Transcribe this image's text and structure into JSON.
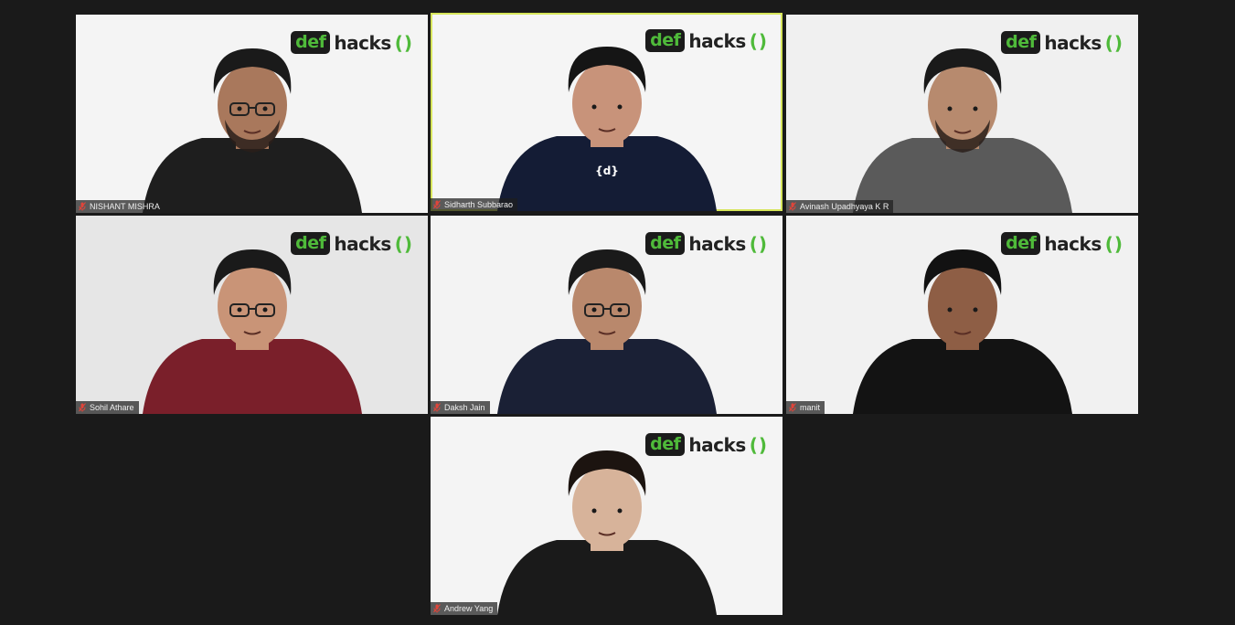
{
  "tiles": [
    {
      "id": "t1",
      "name": "NISHANT MISHRA",
      "bg": "#f4f4f4",
      "shirt": "#1e1e1e",
      "skin": "#a9785c",
      "hair": "#1a1a1a",
      "glasses": true,
      "beard": true,
      "active": false
    },
    {
      "id": "t2",
      "name": "Sidharth Subbarao",
      "bg": "#f5f5f5",
      "shirt": "#141c35",
      "skin": "#c8937a",
      "hair": "#151515",
      "glasses": false,
      "beard": false,
      "active": true,
      "shirt_logo": "{d}"
    },
    {
      "id": "t3",
      "name": "Avinash Upadhyaya K R",
      "bg": "#f0f0f0",
      "shirt": "#5a5a5a",
      "skin": "#b78a6e",
      "hair": "#1a1a1a",
      "glasses": false,
      "beard": true,
      "active": false
    },
    {
      "id": "t4",
      "name": "Sohil Athare",
      "bg": "#e6e6e6",
      "shirt": "#7a1f2a",
      "skin": "#c99477",
      "hair": "#1a1a1a",
      "glasses": true,
      "beard": false,
      "active": false
    },
    {
      "id": "t5",
      "name": "Daksh Jain",
      "bg": "#f3f3f3",
      "shirt": "#1a2035",
      "skin": "#b9886c",
      "hair": "#1a1a1a",
      "glasses": true,
      "beard": false,
      "active": false
    },
    {
      "id": "t6",
      "name": "manit",
      "bg": "#f1f1f1",
      "shirt": "#131313",
      "skin": "#8e5e45",
      "hair": "#121212",
      "glasses": false,
      "beard": false,
      "active": false
    },
    {
      "id": "t7",
      "name": "Andrew Yang",
      "bg": "#f4f4f4",
      "shirt": "#1a1a1a",
      "skin": "#d7b39a",
      "hair": "#1c1410",
      "glasses": false,
      "beard": false,
      "active": false
    }
  ],
  "logo": {
    "def": "def",
    "hacks": "hacks",
    "paren": "()"
  },
  "colors": {
    "accent_green": "#4fba3a",
    "active_border": "#d6e55a",
    "mic_muted": "#e0453a"
  }
}
